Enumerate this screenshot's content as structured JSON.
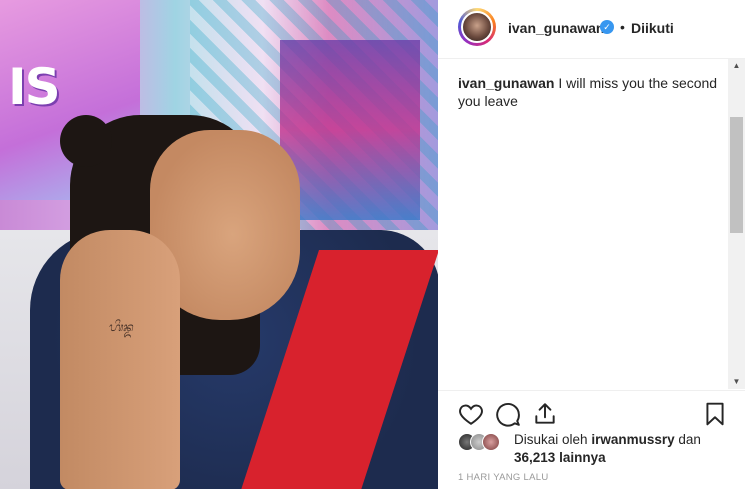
{
  "post": {
    "username": "ivan_gunawan",
    "verified_icon": "verified-badge-icon",
    "follow_separator": "•",
    "follow_status": "Diikuti",
    "caption_user": "ivan_gunawan",
    "caption_text": "I will miss you the second you leave",
    "photo_sign_text": "IS",
    "likes_prefix": "Disukai oleh",
    "likes_user": "irwanmussry",
    "likes_mid": "dan",
    "likes_count": "36,213",
    "likes_suffix": "lainnya",
    "timestamp": "1 HARI YANG LALU"
  },
  "icons": {
    "like": "heart-icon",
    "comment": "comment-icon",
    "share": "share-icon",
    "save": "bookmark-icon"
  },
  "colors": {
    "verified": "#3897f0",
    "text": "#262626",
    "muted": "#999999"
  }
}
